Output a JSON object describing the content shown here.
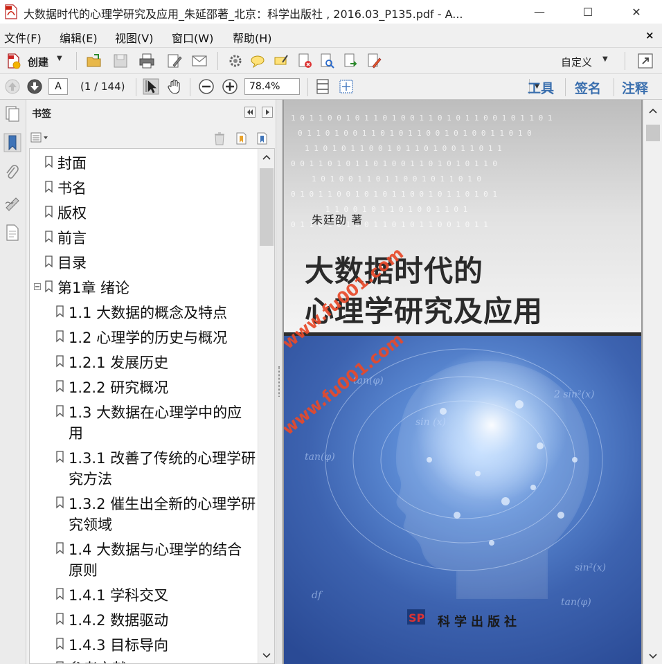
{
  "window": {
    "title": "大数据时代的心理学研究及应用_朱延邵著_北京：科学出版社 , 2016.03_P135.pdf - A...",
    "controls": {
      "minimize": "—",
      "maximize": "☐",
      "close": "✕"
    }
  },
  "menubar": {
    "items": [
      "文件(F)",
      "编辑(E)",
      "视图(V)",
      "窗口(W)",
      "帮助(H)"
    ],
    "close": "×"
  },
  "toolbar": {
    "create_label": "创建",
    "customize_label": "自定义"
  },
  "nav": {
    "page_input": "A",
    "page_count": "(1 / 144)",
    "zoom": "78.4%",
    "panel_tabs": [
      "工具",
      "签名",
      "注释"
    ]
  },
  "bookmarks": {
    "title": "书签",
    "items": [
      {
        "label": "封面"
      },
      {
        "label": "书名"
      },
      {
        "label": "版权"
      },
      {
        "label": "前言"
      },
      {
        "label": "目录"
      },
      {
        "label": "第1章  绪论"
      },
      {
        "label": "1.1  大数据的概念及特点"
      },
      {
        "label": "1.2  心理学的历史与概况"
      },
      {
        "label": "1.2.1  发展历史"
      },
      {
        "label": "1.2.2  研究概况"
      },
      {
        "label": "1.3  大数据在心理学中的应用"
      },
      {
        "label": "1.3.1  改善了传统的心理学研究方法"
      },
      {
        "label": "1.3.2  催生出全新的心理学研究领域"
      },
      {
        "label": "1.4  大数据与心理学的结合原则"
      },
      {
        "label": "1.4.1  学科交叉"
      },
      {
        "label": "1.4.2  数据驱动"
      },
      {
        "label": "1.4.3  目标导向"
      },
      {
        "label": "参考文献"
      }
    ]
  },
  "cover": {
    "author": "朱廷劭  著",
    "title_line1": "大数据时代的",
    "title_line2": "心理学研究及应用",
    "publisher": "科学出版社",
    "watermark": "www.fu001.com"
  },
  "colors": {
    "accent": "#3a6fae",
    "watermark": "#e84a2a",
    "cover_blue": "#3d63b0"
  }
}
